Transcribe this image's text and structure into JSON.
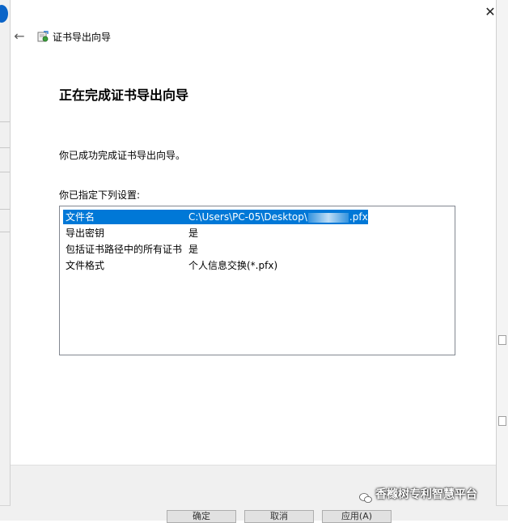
{
  "background": {
    "buttons": [
      "确定",
      "取消",
      "应用(A)"
    ]
  },
  "dialog": {
    "close_glyph": "✕",
    "back_glyph": "←",
    "window_title": "证书导出向导",
    "heading": "正在完成证书导出向导",
    "success_text": "你已成功完成证书导出向导。",
    "specified_label": "你已指定下列设置:",
    "settings": [
      {
        "key": "文件名",
        "value_prefix": "C:\\Users\\PC-05\\Desktop\\",
        "value_suffix": ".pfx",
        "selected": true
      },
      {
        "key": "导出密钥",
        "value": "是",
        "selected": false
      },
      {
        "key": "包括证书路径中的所有证书",
        "value": "是",
        "selected": false
      },
      {
        "key": "文件格式",
        "value": "个人信息交换(*.pfx)",
        "selected": false
      }
    ]
  },
  "watermark": {
    "text": "香橼树专利智慧平台",
    "icon": "wechat-icon"
  },
  "colors": {
    "selection": "#0078d7",
    "footer": "#f0f0f0"
  }
}
